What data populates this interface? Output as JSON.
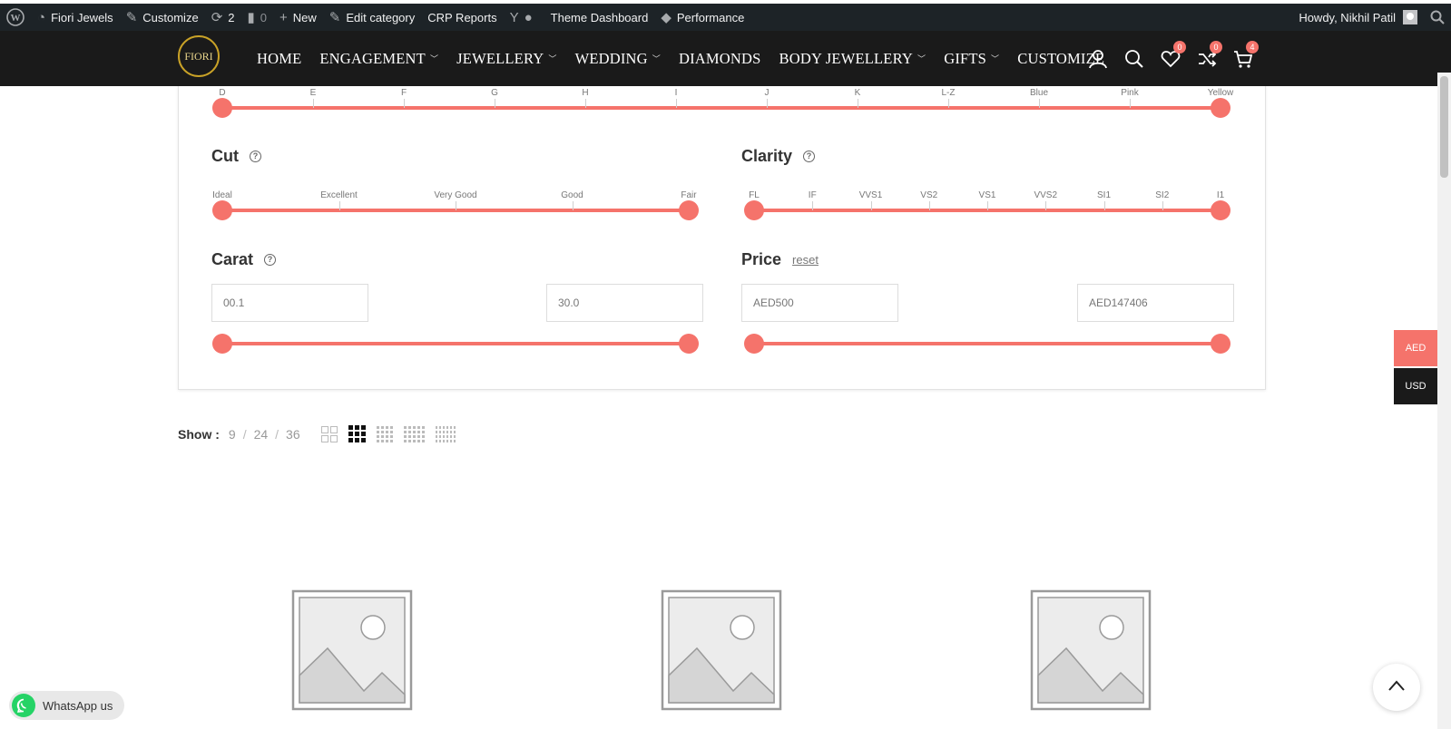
{
  "adminbar": {
    "site": "Fiori Jewels",
    "customize": "Customize",
    "updates": "2",
    "comments": "0",
    "new": "New",
    "edit_category": "Edit category",
    "crp_reports": "CRP Reports",
    "theme_dashboard": "Theme Dashboard",
    "performance": "Performance",
    "howdy": "Howdy, Nikhil Patil"
  },
  "header": {
    "logo_text": "FIORI",
    "nav": [
      "HOME",
      "ENGAGEMENT",
      "JEWELLERY",
      "WEDDING",
      "DIAMONDS",
      "BODY JEWELLERY",
      "GIFTS",
      "CUSTOMIZE"
    ],
    "wishlist_count": "0",
    "compare_count": "0",
    "cart_count": "4"
  },
  "filters": {
    "color_labels": [
      "D",
      "E",
      "F",
      "G",
      "H",
      "I",
      "J",
      "K",
      "L-Z",
      "Blue",
      "Pink",
      "Yellow"
    ],
    "cut": {
      "title": "Cut",
      "labels": [
        "Ideal",
        "Excellent",
        "Very Good",
        "Good",
        "Fair"
      ]
    },
    "clarity": {
      "title": "Clarity",
      "labels": [
        "FL",
        "IF",
        "VVS1",
        "VS2",
        "VS1",
        "VVS2",
        "SI1",
        "SI2",
        "I1"
      ]
    },
    "carat": {
      "title": "Carat",
      "min": "00.1",
      "max": "30.0"
    },
    "price": {
      "title": "Price",
      "reset": "reset",
      "min": "AED500",
      "max": "AED147406"
    }
  },
  "show": {
    "label": "Show :",
    "options": [
      "9",
      "24",
      "36"
    ]
  },
  "currency": {
    "aed": "AED",
    "usd": "USD"
  },
  "whatsapp": {
    "label": "WhatsApp us"
  },
  "colors": {
    "accent": "#f5736b",
    "header": "#1a1a1a",
    "adminbar": "#1d2327"
  }
}
